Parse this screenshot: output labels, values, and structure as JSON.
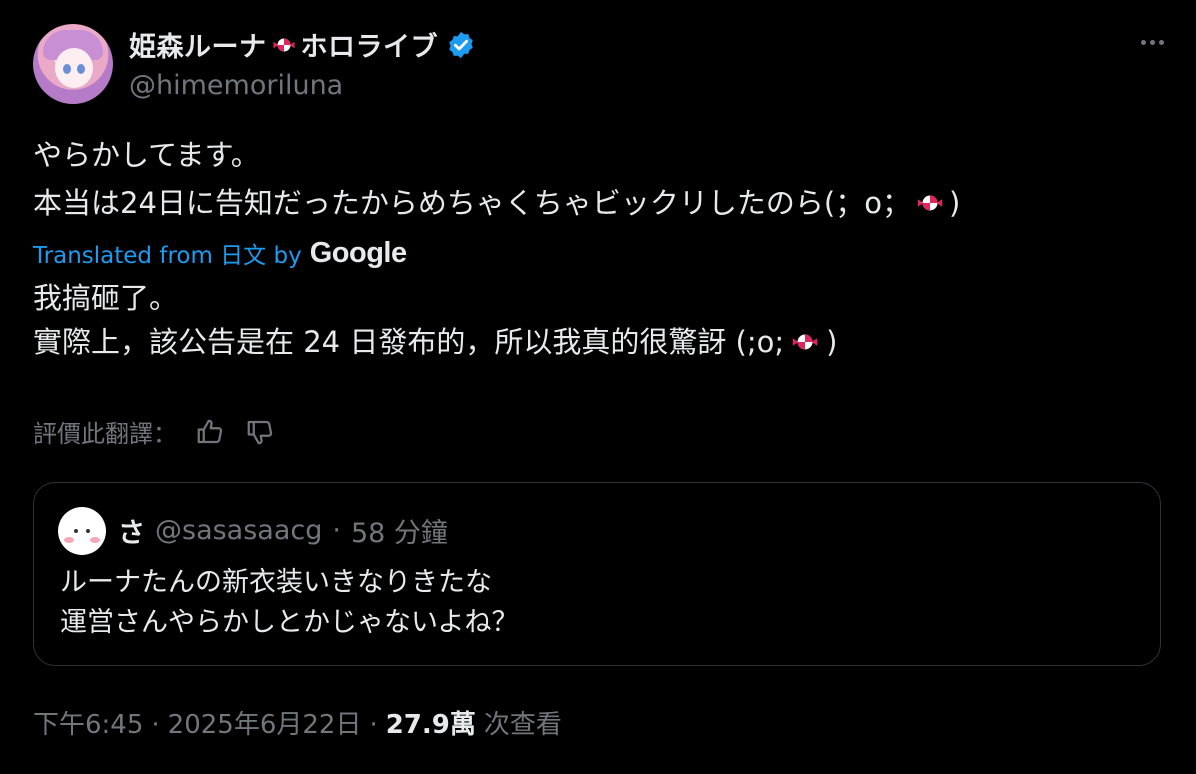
{
  "author": {
    "display_name": "姫森ルーナ",
    "display_suffix": "ホロライブ",
    "handle": "@himemoriluna",
    "verified": true,
    "emoji_icon": "candy-icon"
  },
  "tweet": {
    "line1": "やらかしてます。",
    "line2_prefix": "本当は24日に告知だったからめちゃくちゃビックリしたのら(；o；",
    "line2_suffix": ")"
  },
  "translation": {
    "label": "Translated from 日文 by",
    "brand": "Google",
    "line1": "我搞砸了。",
    "line2_prefix": "實際上，該公告是在 24 日發布的，所以我真的很驚訝 (;o;",
    "line2_suffix": ")",
    "rate_label": "評價此翻譯："
  },
  "quoted_tweet": {
    "name": "さ",
    "handle": "@sasasaacg",
    "separator": "·",
    "time": "58 分鐘",
    "line1": "ルーナたんの新衣装いきなりきたな",
    "line2": "運営さんやらかしとかじゃないよね？"
  },
  "footer": {
    "time": "下午6:45",
    "sep1": "·",
    "date": "2025年6月22日",
    "sep2": "·",
    "views": "27.9萬",
    "views_label": "次查看"
  },
  "colors": {
    "background": "#000000",
    "text": "#e7e9ea",
    "muted": "#71767b",
    "link": "#1d9bf0",
    "border": "#2f3336"
  }
}
